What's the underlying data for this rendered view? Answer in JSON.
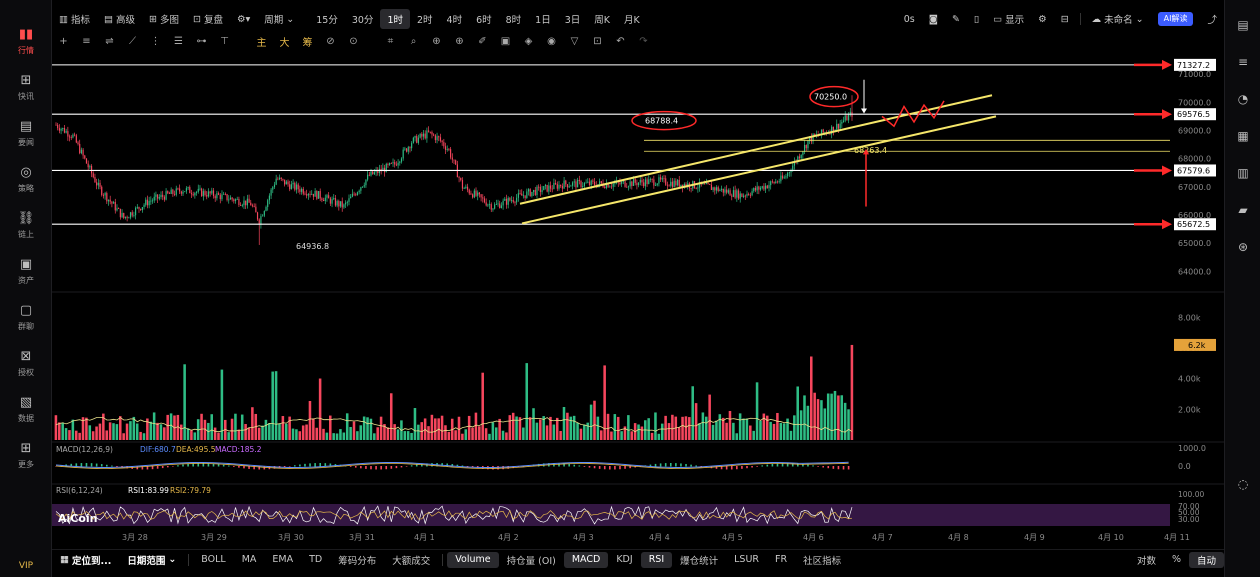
{
  "sidebar": {
    "items": [
      {
        "label": "行情",
        "icon": "bar-chart-icon",
        "active": true
      },
      {
        "label": "快讯",
        "icon": "news-icon"
      },
      {
        "label": "要闻",
        "icon": "document-icon"
      },
      {
        "label": "策略",
        "icon": "robot-icon"
      },
      {
        "label": "链上",
        "icon": "chain-icon"
      },
      {
        "label": "资产",
        "icon": "wallet-icon"
      },
      {
        "label": "群聊",
        "icon": "chat-icon"
      },
      {
        "label": "授权",
        "icon": "key-icon"
      },
      {
        "label": "数据",
        "icon": "data-icon"
      },
      {
        "label": "更多",
        "icon": "grid-icon"
      }
    ],
    "vip": "VIP"
  },
  "topbar": {
    "indicators": "指标",
    "advanced": "高级",
    "multi": "多图",
    "replay": "复盘",
    "period": "周期",
    "intervals": [
      "15分",
      "30分",
      "1时",
      "2时",
      "4时",
      "6时",
      "8时",
      "1日",
      "3日",
      "周K",
      "月K"
    ],
    "active_interval": "1时",
    "timer": "0s",
    "display": "显示",
    "unnamed": "未命名",
    "ai": "AI解读"
  },
  "drawbar": {
    "main": "主",
    "big": "大",
    "chips": "筹"
  },
  "chart": {
    "price_axis": [
      "71000.0",
      "70000.0",
      "69000.0",
      "68000.0",
      "67000.0",
      "66000.0",
      "65000.0",
      "64000.0"
    ],
    "volume_axis": [
      "8.00k",
      "6.00k",
      "4.00k",
      "2.00k"
    ],
    "macd_axis": [
      "1000.0",
      "0.0"
    ],
    "rsi_axis": [
      "100.00",
      "70.00",
      "50.00",
      "30.00"
    ],
    "price_tags": [
      {
        "text": "71327.2",
        "price": 71327.2
      },
      {
        "text": "69576.5",
        "price": 69576.5
      },
      {
        "text": "67579.6",
        "price": 67579.6
      },
      {
        "text": "65672.5",
        "price": 65672.5
      }
    ],
    "volume_tag": "6.2k",
    "annotations": {
      "high": "70250.0",
      "circle_left": "68788.4",
      "mid": "68263.4",
      "low": "64936.8"
    },
    "dates": [
      "3月 28",
      "3月 29",
      "3月 30",
      "3月 31",
      "4月 1",
      "4月 2",
      "4月 3",
      "4月 4",
      "4月 5",
      "4月 6",
      "4月 7",
      "4月 8",
      "4月 9",
      "4月 10",
      "4月 11"
    ],
    "macd_legend": {
      "name": "MACD(12,26,9)",
      "dif": "DIF:680.7",
      "dea": "DEA:495.5",
      "macd": "MACD:185.2"
    },
    "rsi_legend": {
      "name": "RSI(6,12,24)",
      "rsi1": "RSI1:83.99",
      "rsi2": "RSI2:79.79"
    },
    "watermark": "AiCoin",
    "colors": {
      "up": "#2ebd85",
      "down": "#f6465d",
      "line": "#ffffff",
      "trend": "#f5e66a",
      "arrow": "#ff2a2a"
    }
  },
  "bottombar": {
    "locate": "定位到...",
    "date_range": "日期范围",
    "indicators": [
      "BOLL",
      "MA",
      "EMA",
      "TD",
      "筹码分布",
      "大额成交"
    ],
    "sub_indicators": [
      "Volume",
      "持仓量 (OI)",
      "MACD",
      "KDJ",
      "RSI",
      "爆仓统计",
      "LSUR",
      "FR",
      "社区指标"
    ],
    "active": [
      "Volume",
      "MACD",
      "RSI"
    ],
    "log": "对数",
    "percent": "%",
    "auto": "自动"
  },
  "chart_data": {
    "type": "candlestick",
    "series": [
      {
        "name": "price",
        "close_last": 69576.5,
        "high_max": 70250.0,
        "low_min": 64936.8
      }
    ],
    "ylim": [
      63800,
      71500
    ],
    "levels": [
      71327.2,
      69576.5,
      68263.4,
      67579.6,
      65672.5
    ],
    "x": [
      "3月 28",
      "3月 29",
      "3月 30",
      "3月 31",
      "4月 1",
      "4月 2",
      "4月 3",
      "4月 4",
      "4月 5",
      "4月 6",
      "4月 7",
      "4月 8",
      "4月 9",
      "4月 10",
      "4月 11"
    ]
  }
}
